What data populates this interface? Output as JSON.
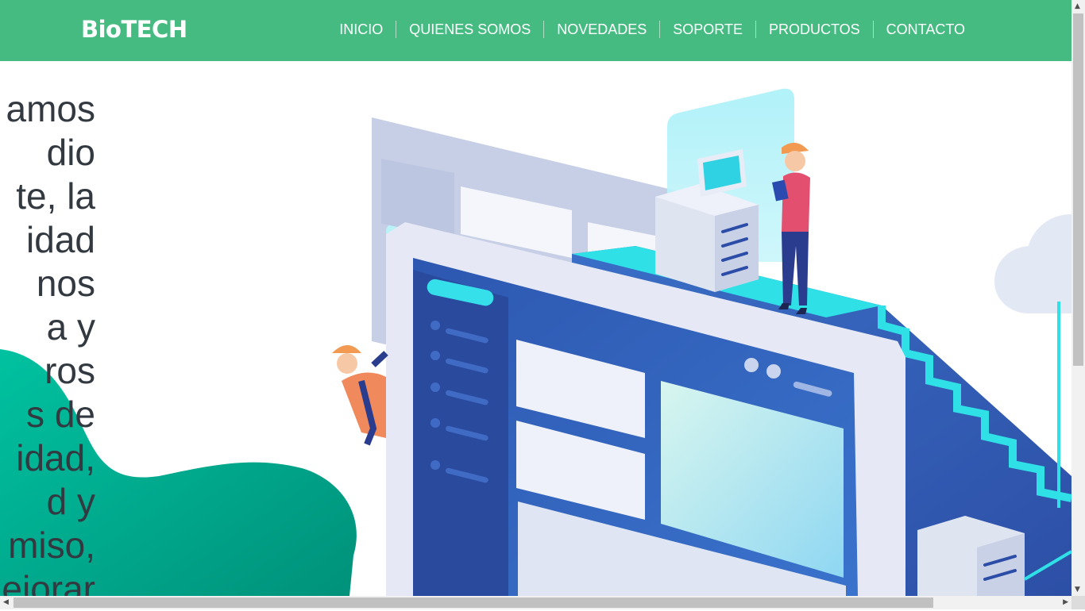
{
  "header": {
    "logo": "BioTECH",
    "nav": [
      "INICIO",
      "QUIENES SOMOS",
      "NOVEDADES",
      "SOPORTE",
      "PRODUCTOS",
      "CONTACTO"
    ]
  },
  "hero": {
    "lines": [
      "amos",
      "dio",
      "te, la",
      "idad",
      "nos",
      "a y",
      "ros",
      "s de",
      "idad,",
      "d y",
      "miso,",
      "ejorar"
    ]
  },
  "colors": {
    "header_bg": "#45bb82",
    "hero_text": "#333940",
    "blob": "#00b99a"
  }
}
